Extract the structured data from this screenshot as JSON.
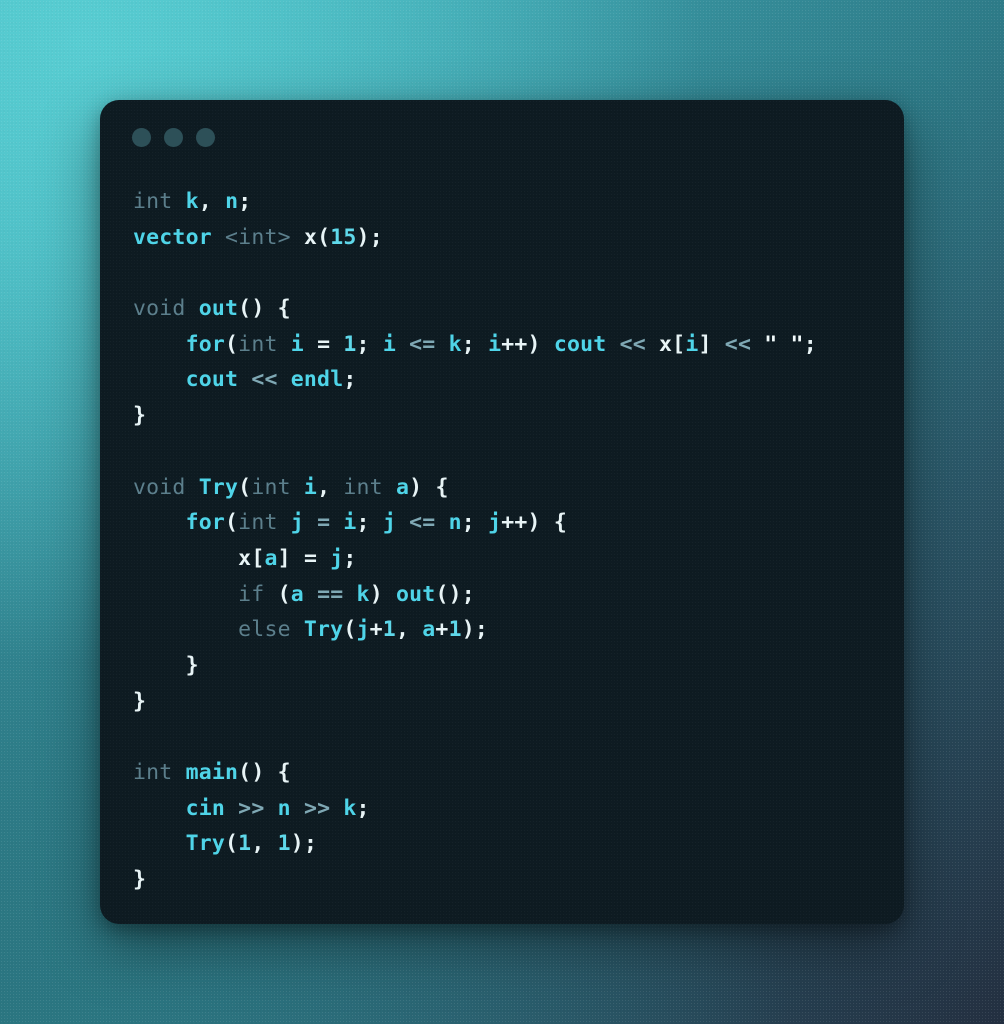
{
  "window": {
    "dots": [
      "close-dot",
      "minimize-dot",
      "maximize-dot"
    ],
    "dot_color": "#2d5058",
    "card_bg": "#0e1b22"
  },
  "theme": {
    "background_gradient_start": "#47bcc4",
    "background_gradient_end": "#232f40",
    "keyword_color": "#5c7f8c",
    "identifier_color": "#4fd4e8",
    "punctuation_color": "#e8f4f6",
    "number_color": "#5fd8ea",
    "string_color": "#f2fbfc",
    "operator_color": "#7fa8b4"
  },
  "code": {
    "language": "cpp",
    "plain_text": "int k, n;\nvector <int> x(15);\n\nvoid out() {\n    for(int i = 1; i <= k; i++) cout << x[i] << \" \";\n    cout << endl;\n}\n\nvoid Try(int i, int a) {\n    for(int j = i; j <= n; j++) {\n        x[a] = j;\n        if (a == k) out();\n        else Try(j+1, a+1);\n    }\n}\n\nint main() {\n    cin >> n >> k;\n    Try(1, 1);\n}",
    "lines": [
      {
        "n": 1,
        "tokens": [
          {
            "t": "int",
            "c": "kw"
          },
          {
            "t": " ",
            "c": "pun"
          },
          {
            "t": "k",
            "c": "id"
          },
          {
            "t": ",",
            "c": "pun"
          },
          {
            "t": " ",
            "c": "pun"
          },
          {
            "t": "n",
            "c": "id"
          },
          {
            "t": ";",
            "c": "pun"
          }
        ]
      },
      {
        "n": 2,
        "tokens": [
          {
            "t": "vector",
            "c": "id"
          },
          {
            "t": " ",
            "c": "pun"
          },
          {
            "t": "<",
            "c": "kw"
          },
          {
            "t": "int",
            "c": "kw"
          },
          {
            "t": ">",
            "c": "kw"
          },
          {
            "t": " ",
            "c": "pun"
          },
          {
            "t": "x",
            "c": "pun"
          },
          {
            "t": "(",
            "c": "pun"
          },
          {
            "t": "15",
            "c": "num"
          },
          {
            "t": ")",
            "c": "pun"
          },
          {
            "t": ";",
            "c": "pun"
          }
        ]
      },
      {
        "n": 3,
        "tokens": []
      },
      {
        "n": 4,
        "tokens": [
          {
            "t": "void",
            "c": "kw"
          },
          {
            "t": " ",
            "c": "pun"
          },
          {
            "t": "out",
            "c": "id"
          },
          {
            "t": "()",
            "c": "pun"
          },
          {
            "t": " ",
            "c": "pun"
          },
          {
            "t": "{",
            "c": "pun"
          }
        ]
      },
      {
        "n": 5,
        "tokens": [
          {
            "t": "    ",
            "c": "pun"
          },
          {
            "t": "for",
            "c": "id"
          },
          {
            "t": "(",
            "c": "pun"
          },
          {
            "t": "int",
            "c": "kw"
          },
          {
            "t": " ",
            "c": "pun"
          },
          {
            "t": "i",
            "c": "id"
          },
          {
            "t": " ",
            "c": "pun"
          },
          {
            "t": "=",
            "c": "pun"
          },
          {
            "t": " ",
            "c": "pun"
          },
          {
            "t": "1",
            "c": "num"
          },
          {
            "t": "; ",
            "c": "pun"
          },
          {
            "t": "i",
            "c": "id"
          },
          {
            "t": " ",
            "c": "pun"
          },
          {
            "t": "<=",
            "c": "op"
          },
          {
            "t": " ",
            "c": "pun"
          },
          {
            "t": "k",
            "c": "id"
          },
          {
            "t": "; ",
            "c": "pun"
          },
          {
            "t": "i",
            "c": "id"
          },
          {
            "t": "++",
            "c": "pun"
          },
          {
            "t": ")",
            "c": "pun"
          },
          {
            "t": " ",
            "c": "pun"
          },
          {
            "t": "cout",
            "c": "id"
          },
          {
            "t": " ",
            "c": "pun"
          },
          {
            "t": "<<",
            "c": "op"
          },
          {
            "t": " ",
            "c": "pun"
          },
          {
            "t": "x",
            "c": "pun"
          },
          {
            "t": "[",
            "c": "pun"
          },
          {
            "t": "i",
            "c": "id"
          },
          {
            "t": "]",
            "c": "pun"
          },
          {
            "t": " ",
            "c": "pun"
          },
          {
            "t": "<<",
            "c": "op"
          },
          {
            "t": " ",
            "c": "pun"
          },
          {
            "t": "\" \"",
            "c": "str"
          },
          {
            "t": ";",
            "c": "pun"
          }
        ]
      },
      {
        "n": 6,
        "tokens": [
          {
            "t": "    ",
            "c": "pun"
          },
          {
            "t": "cout",
            "c": "id"
          },
          {
            "t": " ",
            "c": "pun"
          },
          {
            "t": "<<",
            "c": "op"
          },
          {
            "t": " ",
            "c": "pun"
          },
          {
            "t": "endl",
            "c": "id"
          },
          {
            "t": ";",
            "c": "pun"
          }
        ]
      },
      {
        "n": 7,
        "tokens": [
          {
            "t": "}",
            "c": "pun"
          }
        ]
      },
      {
        "n": 8,
        "tokens": []
      },
      {
        "n": 9,
        "tokens": [
          {
            "t": "void",
            "c": "kw"
          },
          {
            "t": " ",
            "c": "pun"
          },
          {
            "t": "Try",
            "c": "id"
          },
          {
            "t": "(",
            "c": "pun"
          },
          {
            "t": "int",
            "c": "kw"
          },
          {
            "t": " ",
            "c": "pun"
          },
          {
            "t": "i",
            "c": "id"
          },
          {
            "t": ",",
            "c": "pun"
          },
          {
            "t": " ",
            "c": "pun"
          },
          {
            "t": "int",
            "c": "kw"
          },
          {
            "t": " ",
            "c": "pun"
          },
          {
            "t": "a",
            "c": "id"
          },
          {
            "t": ")",
            "c": "pun"
          },
          {
            "t": " ",
            "c": "pun"
          },
          {
            "t": "{",
            "c": "pun"
          }
        ]
      },
      {
        "n": 10,
        "tokens": [
          {
            "t": "    ",
            "c": "pun"
          },
          {
            "t": "for",
            "c": "id"
          },
          {
            "t": "(",
            "c": "pun"
          },
          {
            "t": "int",
            "c": "kw"
          },
          {
            "t": " ",
            "c": "pun"
          },
          {
            "t": "j",
            "c": "id"
          },
          {
            "t": " ",
            "c": "pun"
          },
          {
            "t": "=",
            "c": "op"
          },
          {
            "t": " ",
            "c": "pun"
          },
          {
            "t": "i",
            "c": "id"
          },
          {
            "t": "; ",
            "c": "pun"
          },
          {
            "t": "j",
            "c": "id"
          },
          {
            "t": " ",
            "c": "pun"
          },
          {
            "t": "<=",
            "c": "op"
          },
          {
            "t": " ",
            "c": "pun"
          },
          {
            "t": "n",
            "c": "id"
          },
          {
            "t": "; ",
            "c": "pun"
          },
          {
            "t": "j",
            "c": "id"
          },
          {
            "t": "++",
            "c": "pun"
          },
          {
            "t": ")",
            "c": "pun"
          },
          {
            "t": " ",
            "c": "pun"
          },
          {
            "t": "{",
            "c": "pun"
          }
        ]
      },
      {
        "n": 11,
        "tokens": [
          {
            "t": "        ",
            "c": "pun"
          },
          {
            "t": "x",
            "c": "pun"
          },
          {
            "t": "[",
            "c": "pun"
          },
          {
            "t": "a",
            "c": "id"
          },
          {
            "t": "]",
            "c": "pun"
          },
          {
            "t": " ",
            "c": "pun"
          },
          {
            "t": "=",
            "c": "pun"
          },
          {
            "t": " ",
            "c": "pun"
          },
          {
            "t": "j",
            "c": "id"
          },
          {
            "t": ";",
            "c": "pun"
          }
        ]
      },
      {
        "n": 12,
        "tokens": [
          {
            "t": "        ",
            "c": "pun"
          },
          {
            "t": "if",
            "c": "kw"
          },
          {
            "t": " ",
            "c": "pun"
          },
          {
            "t": "(",
            "c": "pun"
          },
          {
            "t": "a",
            "c": "id"
          },
          {
            "t": " ",
            "c": "pun"
          },
          {
            "t": "==",
            "c": "op"
          },
          {
            "t": " ",
            "c": "pun"
          },
          {
            "t": "k",
            "c": "id"
          },
          {
            "t": ")",
            "c": "pun"
          },
          {
            "t": " ",
            "c": "pun"
          },
          {
            "t": "out",
            "c": "id"
          },
          {
            "t": "();",
            "c": "pun"
          }
        ]
      },
      {
        "n": 13,
        "tokens": [
          {
            "t": "        ",
            "c": "pun"
          },
          {
            "t": "else",
            "c": "kw"
          },
          {
            "t": " ",
            "c": "pun"
          },
          {
            "t": "Try",
            "c": "id"
          },
          {
            "t": "(",
            "c": "pun"
          },
          {
            "t": "j",
            "c": "id"
          },
          {
            "t": "+",
            "c": "pun"
          },
          {
            "t": "1",
            "c": "num"
          },
          {
            "t": ",",
            "c": "pun"
          },
          {
            "t": " ",
            "c": "pun"
          },
          {
            "t": "a",
            "c": "id"
          },
          {
            "t": "+",
            "c": "pun"
          },
          {
            "t": "1",
            "c": "num"
          },
          {
            "t": ");",
            "c": "pun"
          }
        ]
      },
      {
        "n": 14,
        "tokens": [
          {
            "t": "    ",
            "c": "pun"
          },
          {
            "t": "}",
            "c": "pun"
          }
        ]
      },
      {
        "n": 15,
        "tokens": [
          {
            "t": "}",
            "c": "pun"
          }
        ]
      },
      {
        "n": 16,
        "tokens": []
      },
      {
        "n": 17,
        "tokens": [
          {
            "t": "int",
            "c": "kw"
          },
          {
            "t": " ",
            "c": "pun"
          },
          {
            "t": "main",
            "c": "id"
          },
          {
            "t": "()",
            "c": "pun"
          },
          {
            "t": " ",
            "c": "pun"
          },
          {
            "t": "{",
            "c": "pun"
          }
        ]
      },
      {
        "n": 18,
        "tokens": [
          {
            "t": "    ",
            "c": "pun"
          },
          {
            "t": "cin",
            "c": "id"
          },
          {
            "t": " ",
            "c": "pun"
          },
          {
            "t": ">>",
            "c": "op"
          },
          {
            "t": " ",
            "c": "pun"
          },
          {
            "t": "n",
            "c": "id"
          },
          {
            "t": " ",
            "c": "pun"
          },
          {
            "t": ">>",
            "c": "op"
          },
          {
            "t": " ",
            "c": "pun"
          },
          {
            "t": "k",
            "c": "id"
          },
          {
            "t": ";",
            "c": "pun"
          }
        ]
      },
      {
        "n": 19,
        "tokens": [
          {
            "t": "    ",
            "c": "pun"
          },
          {
            "t": "Try",
            "c": "id"
          },
          {
            "t": "(",
            "c": "pun"
          },
          {
            "t": "1",
            "c": "num"
          },
          {
            "t": ",",
            "c": "pun"
          },
          {
            "t": " ",
            "c": "pun"
          },
          {
            "t": "1",
            "c": "num"
          },
          {
            "t": ");",
            "c": "pun"
          }
        ]
      },
      {
        "n": 20,
        "tokens": [
          {
            "t": "}",
            "c": "pun"
          }
        ]
      }
    ]
  }
}
